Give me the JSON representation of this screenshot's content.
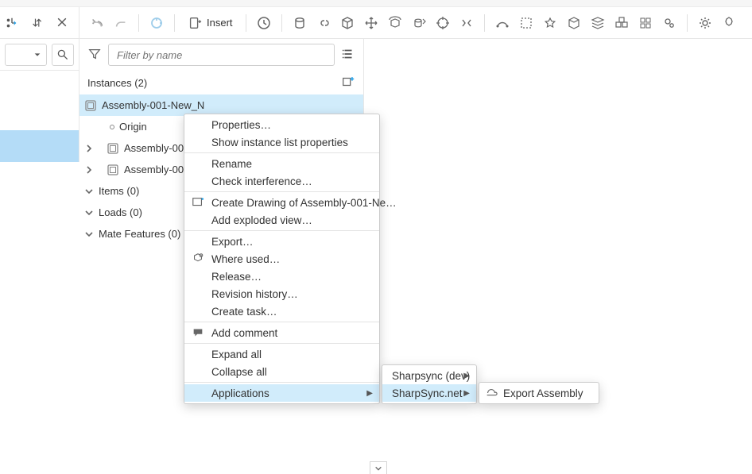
{
  "toolbar": {
    "insert_label": "Insert"
  },
  "filter": {
    "placeholder": "Filter by name"
  },
  "instances_header": "Instances (2)",
  "tree": {
    "n0": "Assembly-001-New_N",
    "n0_origin": "Origin",
    "n0_c1": "Assembly-002",
    "n0_c2": "Assembly-003",
    "items": "Items (0)",
    "loads": "Loads (0)",
    "mate": "Mate Features (0)"
  },
  "ctx": {
    "properties": "Properties…",
    "show_ilp": "Show instance list properties",
    "rename": "Rename",
    "check_int": "Check interference…",
    "create_draw": "Create Drawing of Assembly-001-Ne…",
    "add_expl": "Add exploded view…",
    "export": "Export…",
    "where_used": "Where used…",
    "release": "Release…",
    "rev_hist": "Revision history…",
    "create_task": "Create task…",
    "add_comment": "Add comment",
    "expand_all": "Expand all",
    "collapse_all": "Collapse all",
    "applications": "Applications"
  },
  "apps": {
    "a1": "Sharpsync (dev)",
    "a2": "SharpSync.net"
  },
  "app_action": {
    "export_assembly": "Export Assembly"
  }
}
